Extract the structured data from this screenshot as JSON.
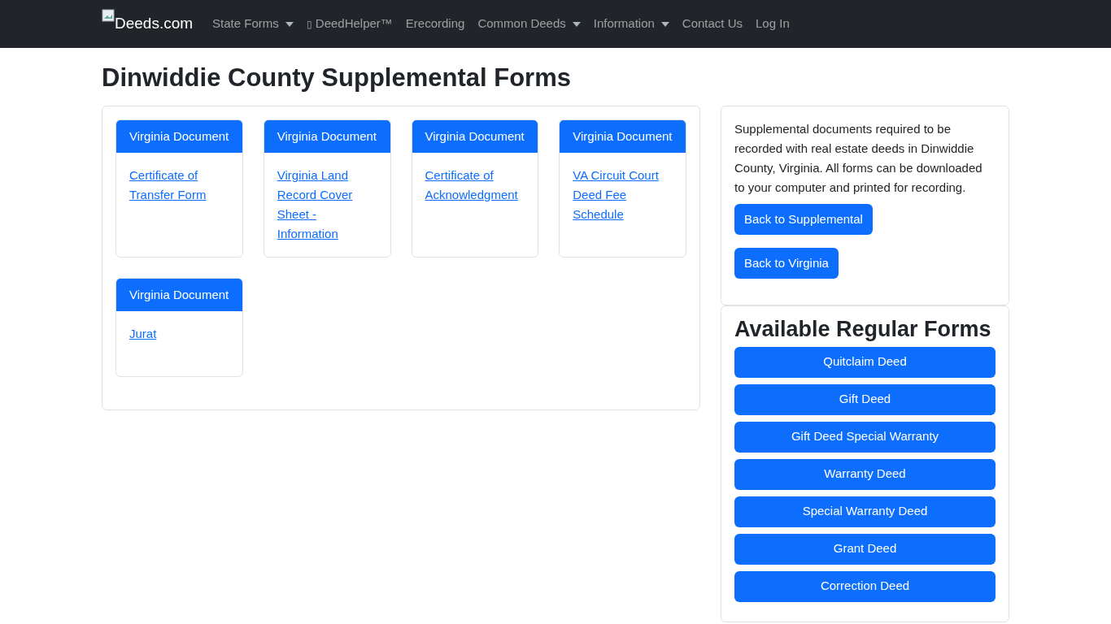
{
  "navbar": {
    "brand": "Deeds.com",
    "items": [
      {
        "label": "State Forms",
        "dropdown": true
      },
      {
        "label": "DeedHelper™",
        "dropdown": false,
        "glyph": "▯"
      },
      {
        "label": "Erecording",
        "dropdown": false
      },
      {
        "label": "Common Deeds",
        "dropdown": true
      },
      {
        "label": "Information",
        "dropdown": true
      },
      {
        "label": "Contact Us",
        "dropdown": false
      },
      {
        "label": "Log In",
        "dropdown": false
      }
    ]
  },
  "title": "Dinwiddie County Supplemental Forms",
  "cards": [
    {
      "header": "Virginia Document",
      "link": "Certificate of Transfer Form"
    },
    {
      "header": "Virginia Document",
      "link": "Virginia Land Record Cover Sheet - Information"
    },
    {
      "header": "Virginia Document",
      "link": "Certificate of Acknowledgment"
    },
    {
      "header": "Virginia Document",
      "link": "VA Circuit Court Deed Fee Schedule"
    },
    {
      "header": "Virginia Document",
      "link": "Jurat"
    }
  ],
  "sidebar": {
    "description": "Supplemental documents required to be recorded with real estate deeds in Dinwiddie County, Virginia. All forms can be downloaded to your computer and printed for recording.",
    "buttons": [
      "Back to Supplemental",
      "Back to Virginia"
    ],
    "regular_title": "Available Regular Forms",
    "regular_forms": [
      "Quitclaim Deed",
      "Gift Deed",
      "Gift Deed Special Warranty",
      "Warranty Deed",
      "Special Warranty Deed",
      "Grant Deed",
      "Correction Deed"
    ]
  }
}
